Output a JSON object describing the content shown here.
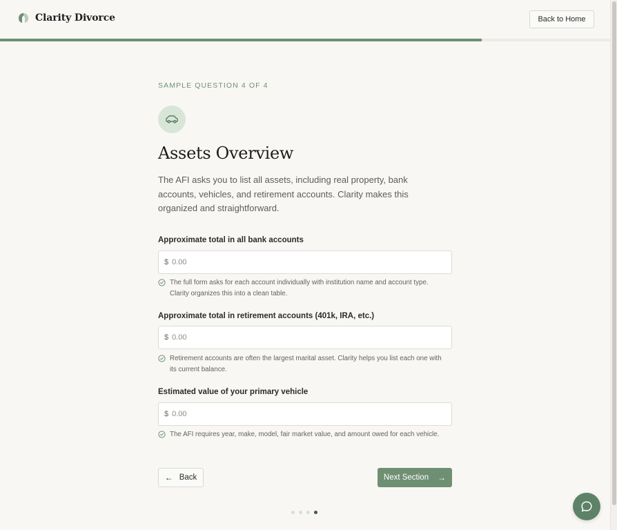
{
  "header": {
    "brand_name": "Clarity Divorce",
    "back_home_label": "Back to Home"
  },
  "progress": {
    "fraction": 0.79
  },
  "question": {
    "eyebrow": "SAMPLE QUESTION 4 OF 4",
    "icon": "car-icon",
    "title": "Assets Overview",
    "intro": "The AFI asks you to list all assets, including real property, bank accounts, vehicles, and retirement accounts. Clarity makes this organized and straightforward."
  },
  "fields": [
    {
      "label": "Approximate total in all bank accounts",
      "currency": "$",
      "placeholder": "0.00",
      "hint": "The full form asks for each account individually with institution name and account type. Clarity organizes this into a clean table."
    },
    {
      "label": "Approximate total in retirement accounts (401k, IRA, etc.)",
      "currency": "$",
      "placeholder": "0.00",
      "hint": "Retirement accounts are often the largest marital asset. Clarity helps you list each one with its current balance."
    },
    {
      "label": "Estimated value of your primary vehicle",
      "currency": "$",
      "placeholder": "0.00",
      "hint": "The AFI requires year, make, model, fair market value, and amount owed for each vehicle."
    }
  ],
  "nav": {
    "back_label": "Back",
    "next_label": "Next Section",
    "step_count": 4,
    "current_step": 4
  },
  "colors": {
    "accent": "#6f8f72",
    "accent_light": "#d8e6d7",
    "background": "#f8f7f4"
  }
}
